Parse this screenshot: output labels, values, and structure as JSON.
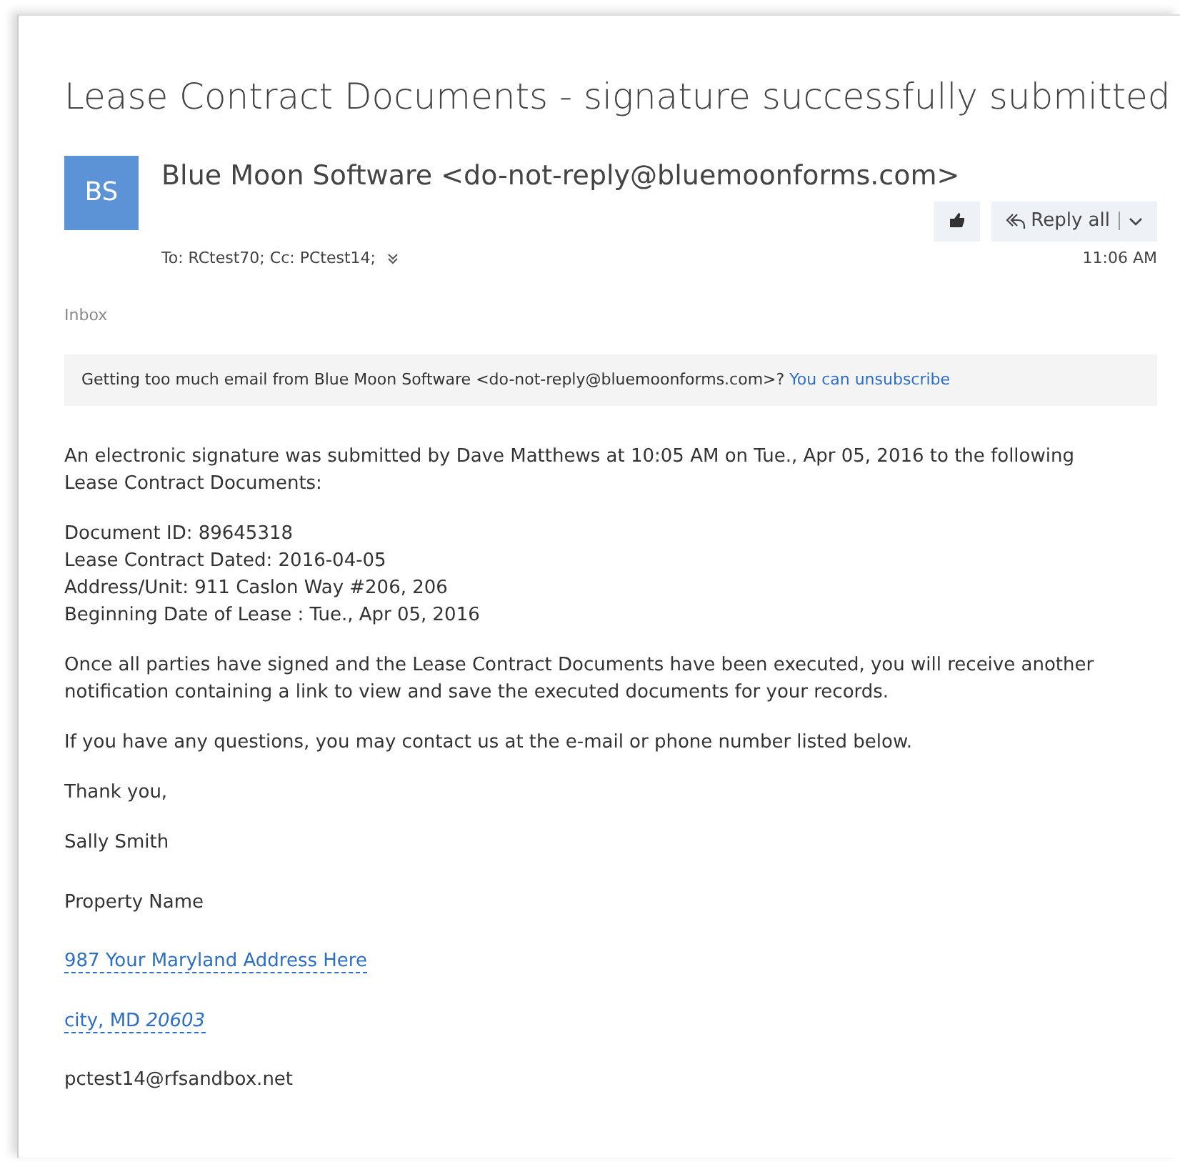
{
  "subject": "Lease Contract Documents - signature successfully submitted",
  "sender": {
    "initials": "BS",
    "name": "Blue Moon Software <do-not-reply@bluemoonforms.com>"
  },
  "reply_label": "Reply all",
  "recipients": "To: RCtest70; Cc: PCtest14;",
  "time": "11:06 AM",
  "folder": "Inbox",
  "banner": {
    "text": "Getting too much email from Blue Moon Software <do-not-reply@bluemoonforms.com>?",
    "link": "You can unsubscribe"
  },
  "body": [
    {
      "kind": "text",
      "text": "An electronic signature was submitted by Dave Matthews at 10:05 AM on Tue., Apr 05, 2016 to the following Lease Contract Documents:"
    },
    {
      "kind": "lines",
      "lines": [
        "Document ID: 89645318",
        "Lease Contract Dated: 2016-04-05",
        "Address/Unit: 911 Caslon Way #206, 206",
        "Beginning Date of Lease : Tue., Apr 05, 2016"
      ]
    },
    {
      "kind": "text",
      "text": "Once all parties have signed and the Lease Contract Documents have been executed, you will receive another notification containing a link to view and save the executed documents for your records."
    },
    {
      "kind": "text",
      "text": "If you have any questions, you may contact us at the e-mail or phone number listed below."
    },
    {
      "kind": "text",
      "text": "Thank you,"
    },
    {
      "kind": "sig",
      "text": "Sally Smith"
    },
    {
      "kind": "sig",
      "text": "Property Name"
    },
    {
      "kind": "link",
      "text": "987 Your Maryland Address Here"
    },
    {
      "kind": "link",
      "text": "city, MD *20603*"
    },
    {
      "kind": "sig",
      "text": "pctest14@rfsandbox.net"
    }
  ]
}
